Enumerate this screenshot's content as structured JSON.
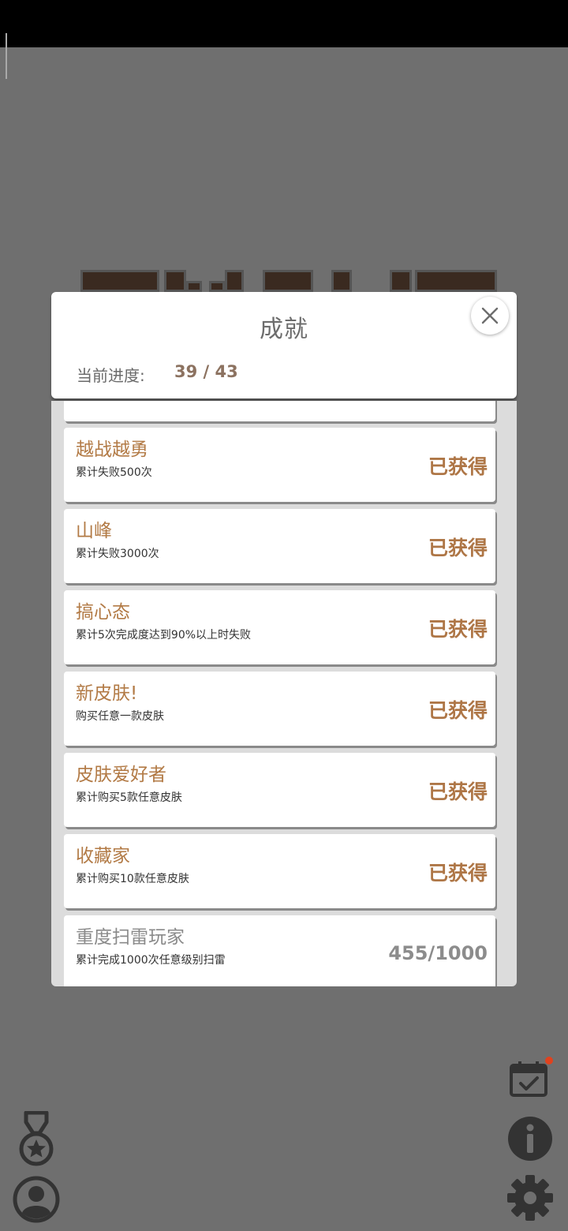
{
  "dialog": {
    "title": "成就",
    "progress_label": "当前进度:",
    "progress_value": "39 / 43"
  },
  "achievements": [
    {
      "name": "越战越勇",
      "desc": "累计失败500次",
      "status": "已获得",
      "earned": true
    },
    {
      "name": "山峰",
      "desc": "累计失败3000次",
      "status": "已获得",
      "earned": true
    },
    {
      "name": "搞心态",
      "desc": "累计5次完成度达到90%以上时失败",
      "status": "已获得",
      "earned": true
    },
    {
      "name": "新皮肤!",
      "desc": "购买任意一款皮肤",
      "status": "已获得",
      "earned": true
    },
    {
      "name": "皮肤爱好者",
      "desc": "累计购买5款任意皮肤",
      "status": "已获得",
      "earned": true
    },
    {
      "name": "收藏家",
      "desc": "累计购买10款任意皮肤",
      "status": "已获得",
      "earned": true
    },
    {
      "name": "重度扫雷玩家",
      "desc": "累计完成1000次任意级别扫雷",
      "status": "455/1000",
      "earned": false
    }
  ],
  "icons": {
    "close": "close-icon",
    "medal": "medal-icon",
    "profile": "profile-icon",
    "calendar": "calendar-check-icon",
    "info": "info-icon",
    "settings": "gear-icon"
  },
  "colors": {
    "accent": "#ae7646",
    "overlay": "#6f6f6f",
    "notification": "#e0421e"
  }
}
